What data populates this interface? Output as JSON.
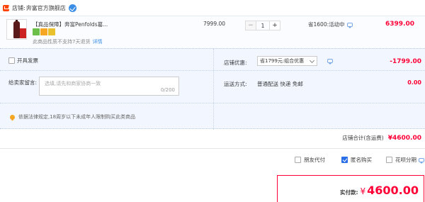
{
  "shop": {
    "label": "店铺:",
    "name": "奔富官方旗舰店"
  },
  "item": {
    "title": "【真品保障】奔富Penfolds葛...",
    "note": "此商品性质不支持7天退货",
    "note_link": "详情",
    "unit_price": "7999.00",
    "quantity": "1",
    "qty_minus": "−",
    "qty_plus": "+",
    "promo": "省1600:活动中",
    "line_total": "6399.00"
  },
  "invoice": {
    "label": "开具发票"
  },
  "message": {
    "label": "给卖家留言:",
    "placeholder": "选填,请先和商家协商一致",
    "counter": "0/200"
  },
  "legal_notice": "依据法律规定,18周岁以下未成年人限制购买此类商品",
  "discount": {
    "label": "店铺优惠:",
    "selected": "省1799元:组合优惠",
    "amount": "-1799.00"
  },
  "shipping": {
    "label": "运送方式:",
    "value": "普通配送 快递 免邮",
    "amount": "0.00"
  },
  "subtotal": {
    "label": "店铺合计(含运费)",
    "amount": "¥4600.00"
  },
  "options": {
    "friend_pay": "朋友代付",
    "anonymous": "匿名购买",
    "installment": "花呗分期"
  },
  "payment": {
    "label": "实付款:",
    "currency": "¥",
    "amount": "4600.00"
  },
  "colors": {
    "price_red": "#ff0036",
    "accent_blue": "#2a6ee8",
    "detail_bg": "#f2f7ff"
  },
  "icons": [
    "shop-icon",
    "verified-badge-icon",
    "chat-icon",
    "pin-icon",
    "chevron-down-icon"
  ]
}
